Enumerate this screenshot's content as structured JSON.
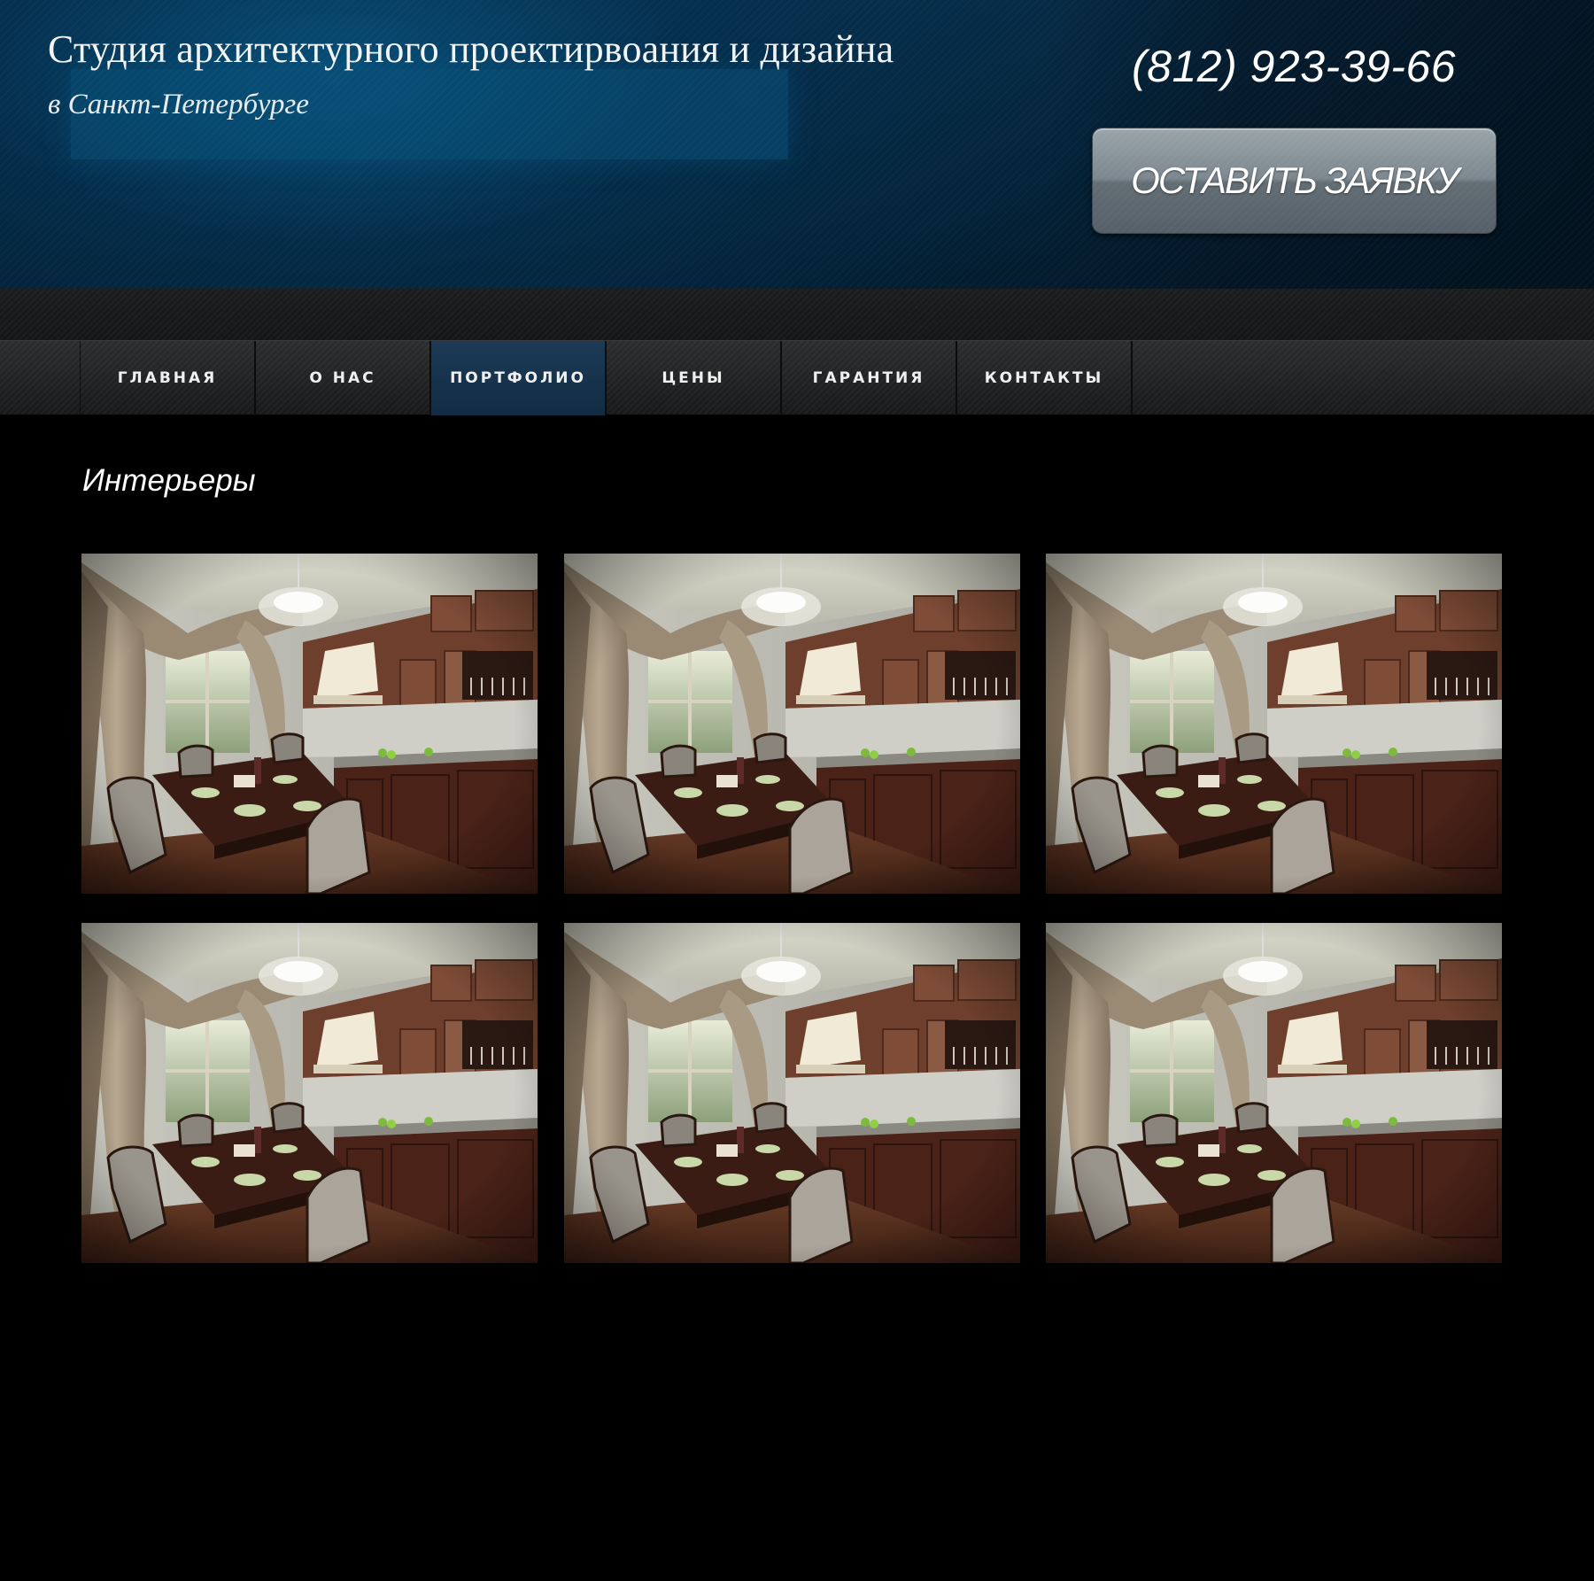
{
  "header": {
    "title": "Студия архитектурного проектирвоания и дизайна",
    "subtitle": "в Санкт-Петербурге",
    "phone": "(812) 923-39-66",
    "cta_label": "ОСТАВИТЬ ЗАЯВКУ"
  },
  "nav": {
    "items": [
      {
        "label": "ГЛАВНАЯ",
        "active": false
      },
      {
        "label": "О НАС",
        "active": false
      },
      {
        "label": "ПОРТФОЛИО",
        "active": true
      },
      {
        "label": "ЦЕНЫ",
        "active": false
      },
      {
        "label": "ГАРАНТИЯ",
        "active": false
      },
      {
        "label": "КОНТАКТЫ",
        "active": false
      }
    ]
  },
  "main": {
    "section_title": "Интерьеры",
    "gallery": [
      {
        "image": "kitchen-interior-render"
      },
      {
        "image": "kitchen-interior-render"
      },
      {
        "image": "kitchen-interior-render"
      },
      {
        "image": "kitchen-interior-render"
      },
      {
        "image": "kitchen-interior-render"
      },
      {
        "image": "kitchen-interior-render"
      }
    ]
  },
  "colors": {
    "header_blue": "#043a5e",
    "nav_active": "#163552",
    "background": "#000000"
  }
}
